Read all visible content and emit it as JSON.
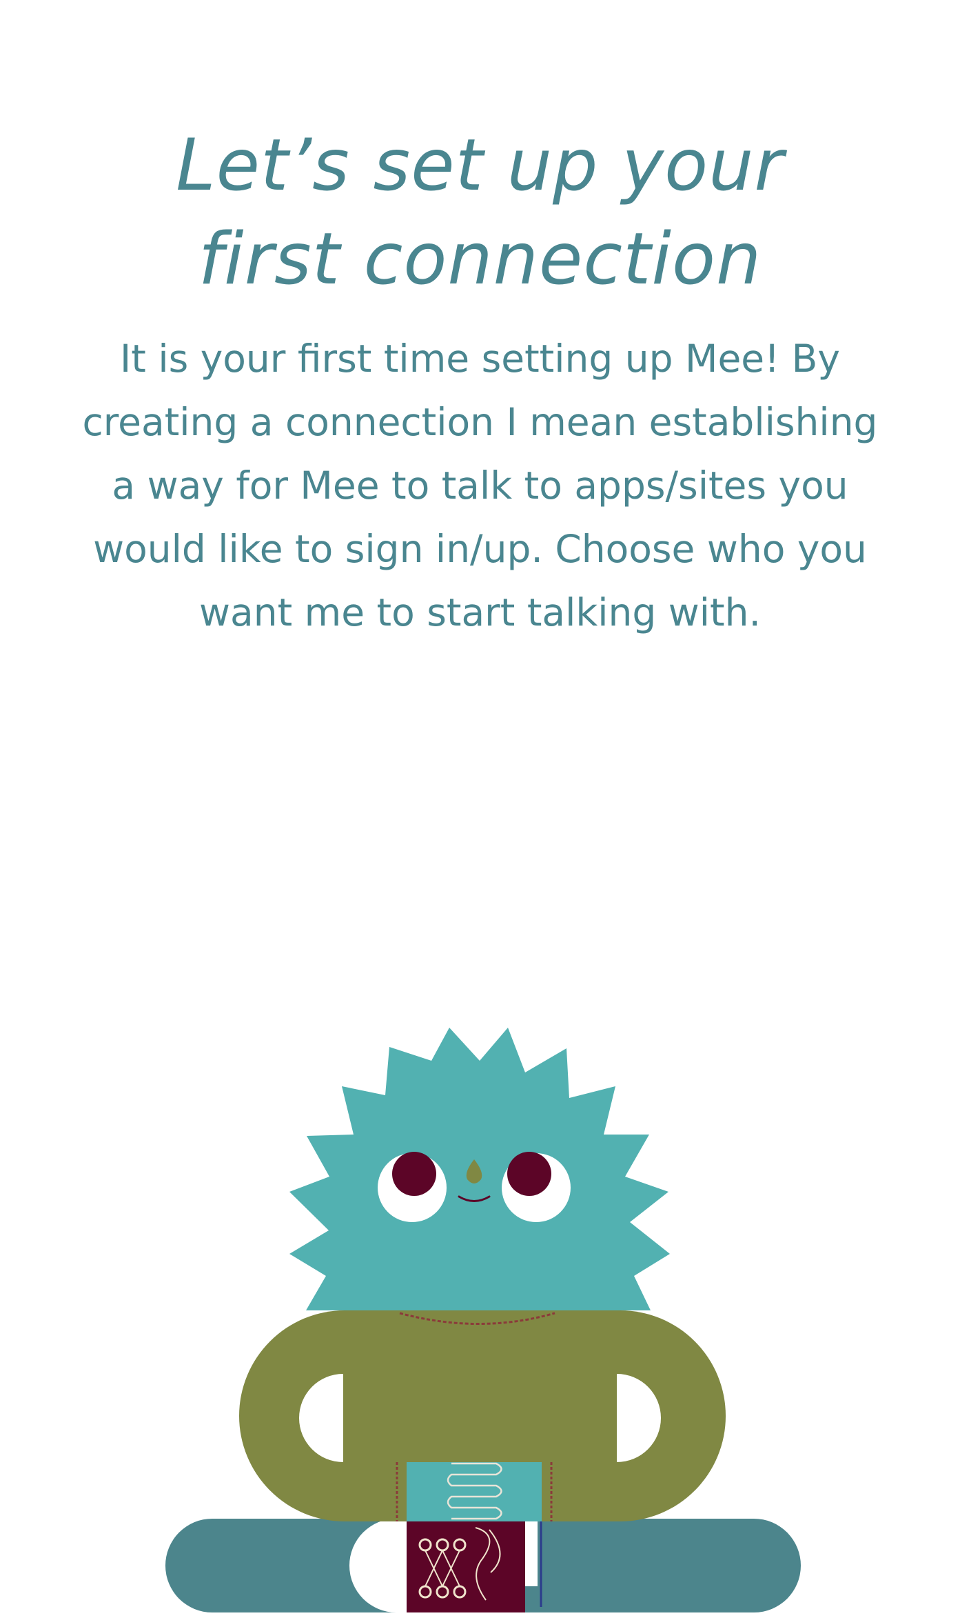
{
  "onboarding": {
    "title_line1": "Let’s set up your",
    "title_line2": "first connection",
    "body": "It is your first time setting up Mee!  By creating a connection I mean establishing a way for Mee to talk to apps/sites you would like to sign in/up. Choose who you want me to start talking with."
  },
  "mascot": {
    "icon": "mee-mascot-illustration"
  },
  "colors": {
    "text": "#4a8690",
    "head": "#52b1b1",
    "body": "#808843",
    "legs": "#4c858c",
    "eyes": "#5c0527",
    "book": "#5c0527",
    "background": "#ffffff"
  }
}
